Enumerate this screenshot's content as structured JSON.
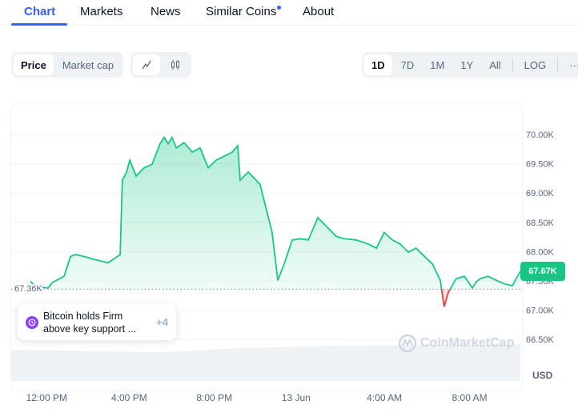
{
  "tabs": [
    {
      "label": "Chart",
      "active": true
    },
    {
      "label": "Markets"
    },
    {
      "label": "News"
    },
    {
      "label": "Similar Coins",
      "has_dot": true
    },
    {
      "label": "About"
    }
  ],
  "toolbar": {
    "metric_options": [
      "Price",
      "Market cap"
    ],
    "metric_selected": "Price",
    "chart_types": [
      {
        "icon": "line-chart-icon",
        "selected": true
      },
      {
        "icon": "candlestick-icon"
      }
    ],
    "ranges": [
      "1D",
      "7D",
      "1M",
      "1Y",
      "All"
    ],
    "range_selected": "1D",
    "log_label": "LOG",
    "more_label": "···"
  },
  "news": {
    "headline": "Bitcoin holds Firm above key support ...",
    "more": "+4",
    "icon": "clock-history-icon"
  },
  "watermark": "CoinMarketCap",
  "colors": {
    "accent": "#3861fb",
    "up": "#16c784",
    "down": "#ea3943"
  },
  "chart_data": {
    "type": "area",
    "currency": "USD",
    "baseline": 67360,
    "baseline_label": "67.36K",
    "current_label": "67.67K",
    "ylim": [
      65790,
      70520
    ],
    "y_ticks": [
      {
        "v": 70000,
        "l": "70.00K"
      },
      {
        "v": 69500,
        "l": "69.50K"
      },
      {
        "v": 69000,
        "l": "69.00K"
      },
      {
        "v": 68500,
        "l": "68.50K"
      },
      {
        "v": 68000,
        "l": "68.00K"
      },
      {
        "v": 67500,
        "l": "67.50K"
      },
      {
        "v": 67000,
        "l": "67.00K"
      },
      {
        "v": 66500,
        "l": "66.50K"
      }
    ],
    "x_ticks": [
      {
        "t": "12 Jun 12:00",
        "l": "12:00 PM"
      },
      {
        "t": "12 Jun 16:00",
        "l": "4:00 PM"
      },
      {
        "t": "12 Jun 20:00",
        "l": "8:00 PM"
      },
      {
        "t": "13 Jun 00:00",
        "l": "13 Jun"
      },
      {
        "t": "13 Jun 04:00",
        "l": "4:00 AM"
      },
      {
        "t": "13 Jun 08:00",
        "l": "8:00 AM"
      }
    ],
    "points": [
      [
        "12 Jun 11:18",
        67490
      ],
      [
        "12 Jun 11:34",
        67400
      ],
      [
        "12 Jun 12:08",
        67380
      ],
      [
        "12 Jun 12:19",
        67470
      ],
      [
        "12 Jun 12:53",
        67580
      ],
      [
        "12 Jun 13:11",
        67920
      ],
      [
        "12 Jun 13:27",
        67950
      ],
      [
        "12 Jun 14:00",
        67900
      ],
      [
        "12 Jun 14:23",
        67860
      ],
      [
        "12 Jun 14:57",
        67810
      ],
      [
        "12 Jun 15:31",
        67950
      ],
      [
        "12 Jun 15:37",
        69220
      ],
      [
        "12 Jun 15:49",
        69360
      ],
      [
        "12 Jun 15:58",
        69560
      ],
      [
        "12 Jun 16:16",
        69290
      ],
      [
        "12 Jun 16:38",
        69430
      ],
      [
        "12 Jun 17:01",
        69490
      ],
      [
        "12 Jun 17:23",
        69840
      ],
      [
        "12 Jun 17:35",
        69950
      ],
      [
        "12 Jun 17:46",
        69840
      ],
      [
        "12 Jun 17:57",
        69950
      ],
      [
        "12 Jun 18:09",
        69770
      ],
      [
        "12 Jun 18:31",
        69860
      ],
      [
        "12 Jun 18:54",
        69700
      ],
      [
        "12 Jun 19:16",
        69770
      ],
      [
        "12 Jun 19:39",
        69430
      ],
      [
        "12 Jun 20:01",
        69560
      ],
      [
        "12 Jun 20:24",
        69630
      ],
      [
        "12 Jun 20:47",
        69700
      ],
      [
        "12 Jun 21:02",
        69810
      ],
      [
        "12 Jun 21:09",
        69220
      ],
      [
        "12 Jun 21:32",
        69360
      ],
      [
        "12 Jun 22:05",
        69150
      ],
      [
        "12 Jun 22:39",
        68330
      ],
      [
        "12 Jun 22:55",
        67510
      ],
      [
        "12 Jun 23:13",
        67790
      ],
      [
        "12 Jun 23:36",
        68200
      ],
      [
        "12 Jun 23:58",
        68220
      ],
      [
        "13 Jun 00:21",
        68200
      ],
      [
        "13 Jun 00:48",
        68580
      ],
      [
        "13 Jun 01:17",
        68400
      ],
      [
        "13 Jun 01:40",
        68260
      ],
      [
        "13 Jun 02:02",
        68220
      ],
      [
        "13 Jun 02:36",
        68200
      ],
      [
        "13 Jun 03:10",
        68130
      ],
      [
        "13 Jun 03:33",
        68060
      ],
      [
        "13 Jun 03:55",
        68330
      ],
      [
        "13 Jun 04:18",
        68200
      ],
      [
        "13 Jun 04:40",
        68130
      ],
      [
        "13 Jun 05:03",
        67990
      ],
      [
        "13 Jun 05:25",
        68060
      ],
      [
        "13 Jun 05:48",
        67920
      ],
      [
        "13 Jun 06:11",
        67790
      ],
      [
        "13 Jun 06:33",
        67510
      ],
      [
        "13 Jun 06:44",
        67060
      ],
      [
        "13 Jun 06:56",
        67310
      ],
      [
        "13 Jun 07:18",
        67540
      ],
      [
        "13 Jun 07:41",
        67580
      ],
      [
        "13 Jun 08:03",
        67380
      ],
      [
        "13 Jun 08:15",
        67490
      ],
      [
        "13 Jun 08:26",
        67540
      ],
      [
        "13 Jun 08:48",
        67580
      ],
      [
        "13 Jun 09:11",
        67510
      ],
      [
        "13 Jun 09:34",
        67450
      ],
      [
        "13 Jun 09:56",
        67420
      ],
      [
        "13 Jun 10:19",
        67670
      ]
    ]
  }
}
